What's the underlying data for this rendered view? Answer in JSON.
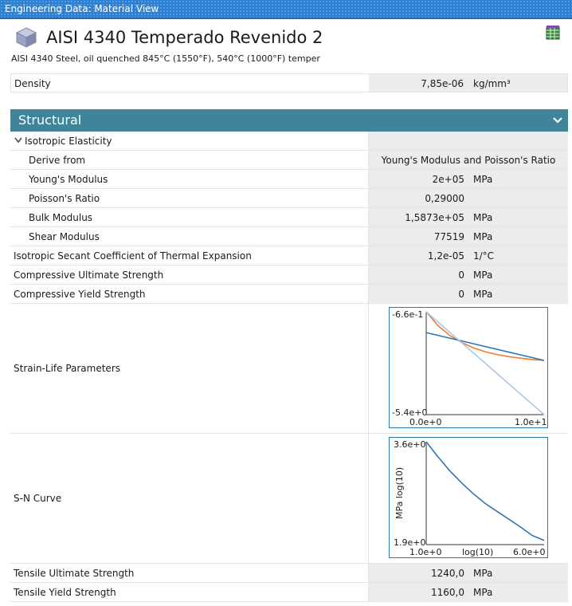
{
  "window": {
    "title": "Engineering Data: Material View"
  },
  "material": {
    "name": "AISI 4340 Temperado Revenido 2",
    "description": "AISI 4340 Steel, oil quenched 845°C (1550°F), 540°C (1000°F) temper",
    "icon": "cube-icon",
    "library_icon": "library-grid-icon",
    "density": {
      "label": "Density",
      "value": "7,85e-06",
      "unit": "kg/mm³"
    }
  },
  "section": {
    "title": "Structural",
    "toggle_icon": "chevron-down-icon",
    "accent_color": "#3f8499"
  },
  "elasticity": {
    "label": "Isotropic Elasticity",
    "expand_icon": "chevron-down-icon",
    "derive_from": {
      "label": "Derive from",
      "value": "Young's Modulus and Poisson's Ratio"
    },
    "youngs": {
      "label": "Young's Modulus",
      "value": "2e+05",
      "unit": "MPa"
    },
    "poisson": {
      "label": "Poisson's Ratio",
      "value": "0,29000"
    },
    "bulk": {
      "label": "Bulk Modulus",
      "value": "1,5873e+05",
      "unit": "MPa"
    },
    "shear": {
      "label": "Shear Modulus",
      "value": "77519",
      "unit": "MPa"
    }
  },
  "thermal_expansion": {
    "label": "Isotropic Secant Coefficient of Thermal Expansion",
    "value": "1,2e-05",
    "unit": "1/°C"
  },
  "compressive_ultimate": {
    "label": "Compressive Ultimate Strength",
    "value": "0",
    "unit": "MPa"
  },
  "compressive_yield": {
    "label": "Compressive Yield Strength",
    "value": "0",
    "unit": "MPa"
  },
  "strain_life": {
    "label": "Strain-Life Parameters",
    "y_top_label": "-6.6e-1",
    "y_bottom_label": "-5.4e+0",
    "x_left_label": "0.0e+0",
    "x_right_label": "1.0e+1"
  },
  "sn_curve": {
    "label": "S-N Curve",
    "y_top_label": "3.6e+0",
    "y_bottom_label": "1.9e+0",
    "x_left_label": "1.0e+0",
    "x_mid_label": "log(10)",
    "x_right_label": "6.0e+0",
    "y_axis_label": "MPa log(10)"
  },
  "tensile_ultimate": {
    "label": "Tensile Ultimate Strength",
    "value": "1240,0",
    "unit": "MPa"
  },
  "tensile_yield": {
    "label": "Tensile Yield Strength",
    "value": "1160,0",
    "unit": "MPa"
  },
  "chart_data": [
    {
      "type": "line",
      "xlim": [
        0,
        10
      ],
      "ylim": [
        -5.4,
        -0.66
      ],
      "series": [
        {
          "color": "#ed7d31",
          "x": [
            0,
            1,
            2,
            3,
            4,
            5,
            6,
            7,
            8,
            9,
            10
          ],
          "y": [
            -0.66,
            -1.3,
            -1.75,
            -2.08,
            -2.32,
            -2.5,
            -2.63,
            -2.73,
            -2.8,
            -2.86,
            -2.9
          ]
        },
        {
          "color": "#2e75b6",
          "x": [
            0,
            10
          ],
          "y": [
            -1.62,
            -2.9
          ]
        },
        {
          "color": "#a9c8e8",
          "x": [
            0,
            10
          ],
          "y": [
            -0.66,
            -5.4
          ]
        }
      ]
    },
    {
      "type": "line",
      "xlim": [
        1,
        6
      ],
      "ylim": [
        1.9,
        3.6
      ],
      "series": [
        {
          "color": "#2e75b6",
          "x": [
            1,
            1.5,
            2,
            2.5,
            3,
            3.5,
            4,
            4.5,
            5,
            5.5,
            6
          ],
          "y": [
            3.6,
            3.35,
            3.12,
            2.92,
            2.74,
            2.58,
            2.45,
            2.32,
            2.19,
            2.05,
            1.97
          ]
        }
      ]
    }
  ]
}
